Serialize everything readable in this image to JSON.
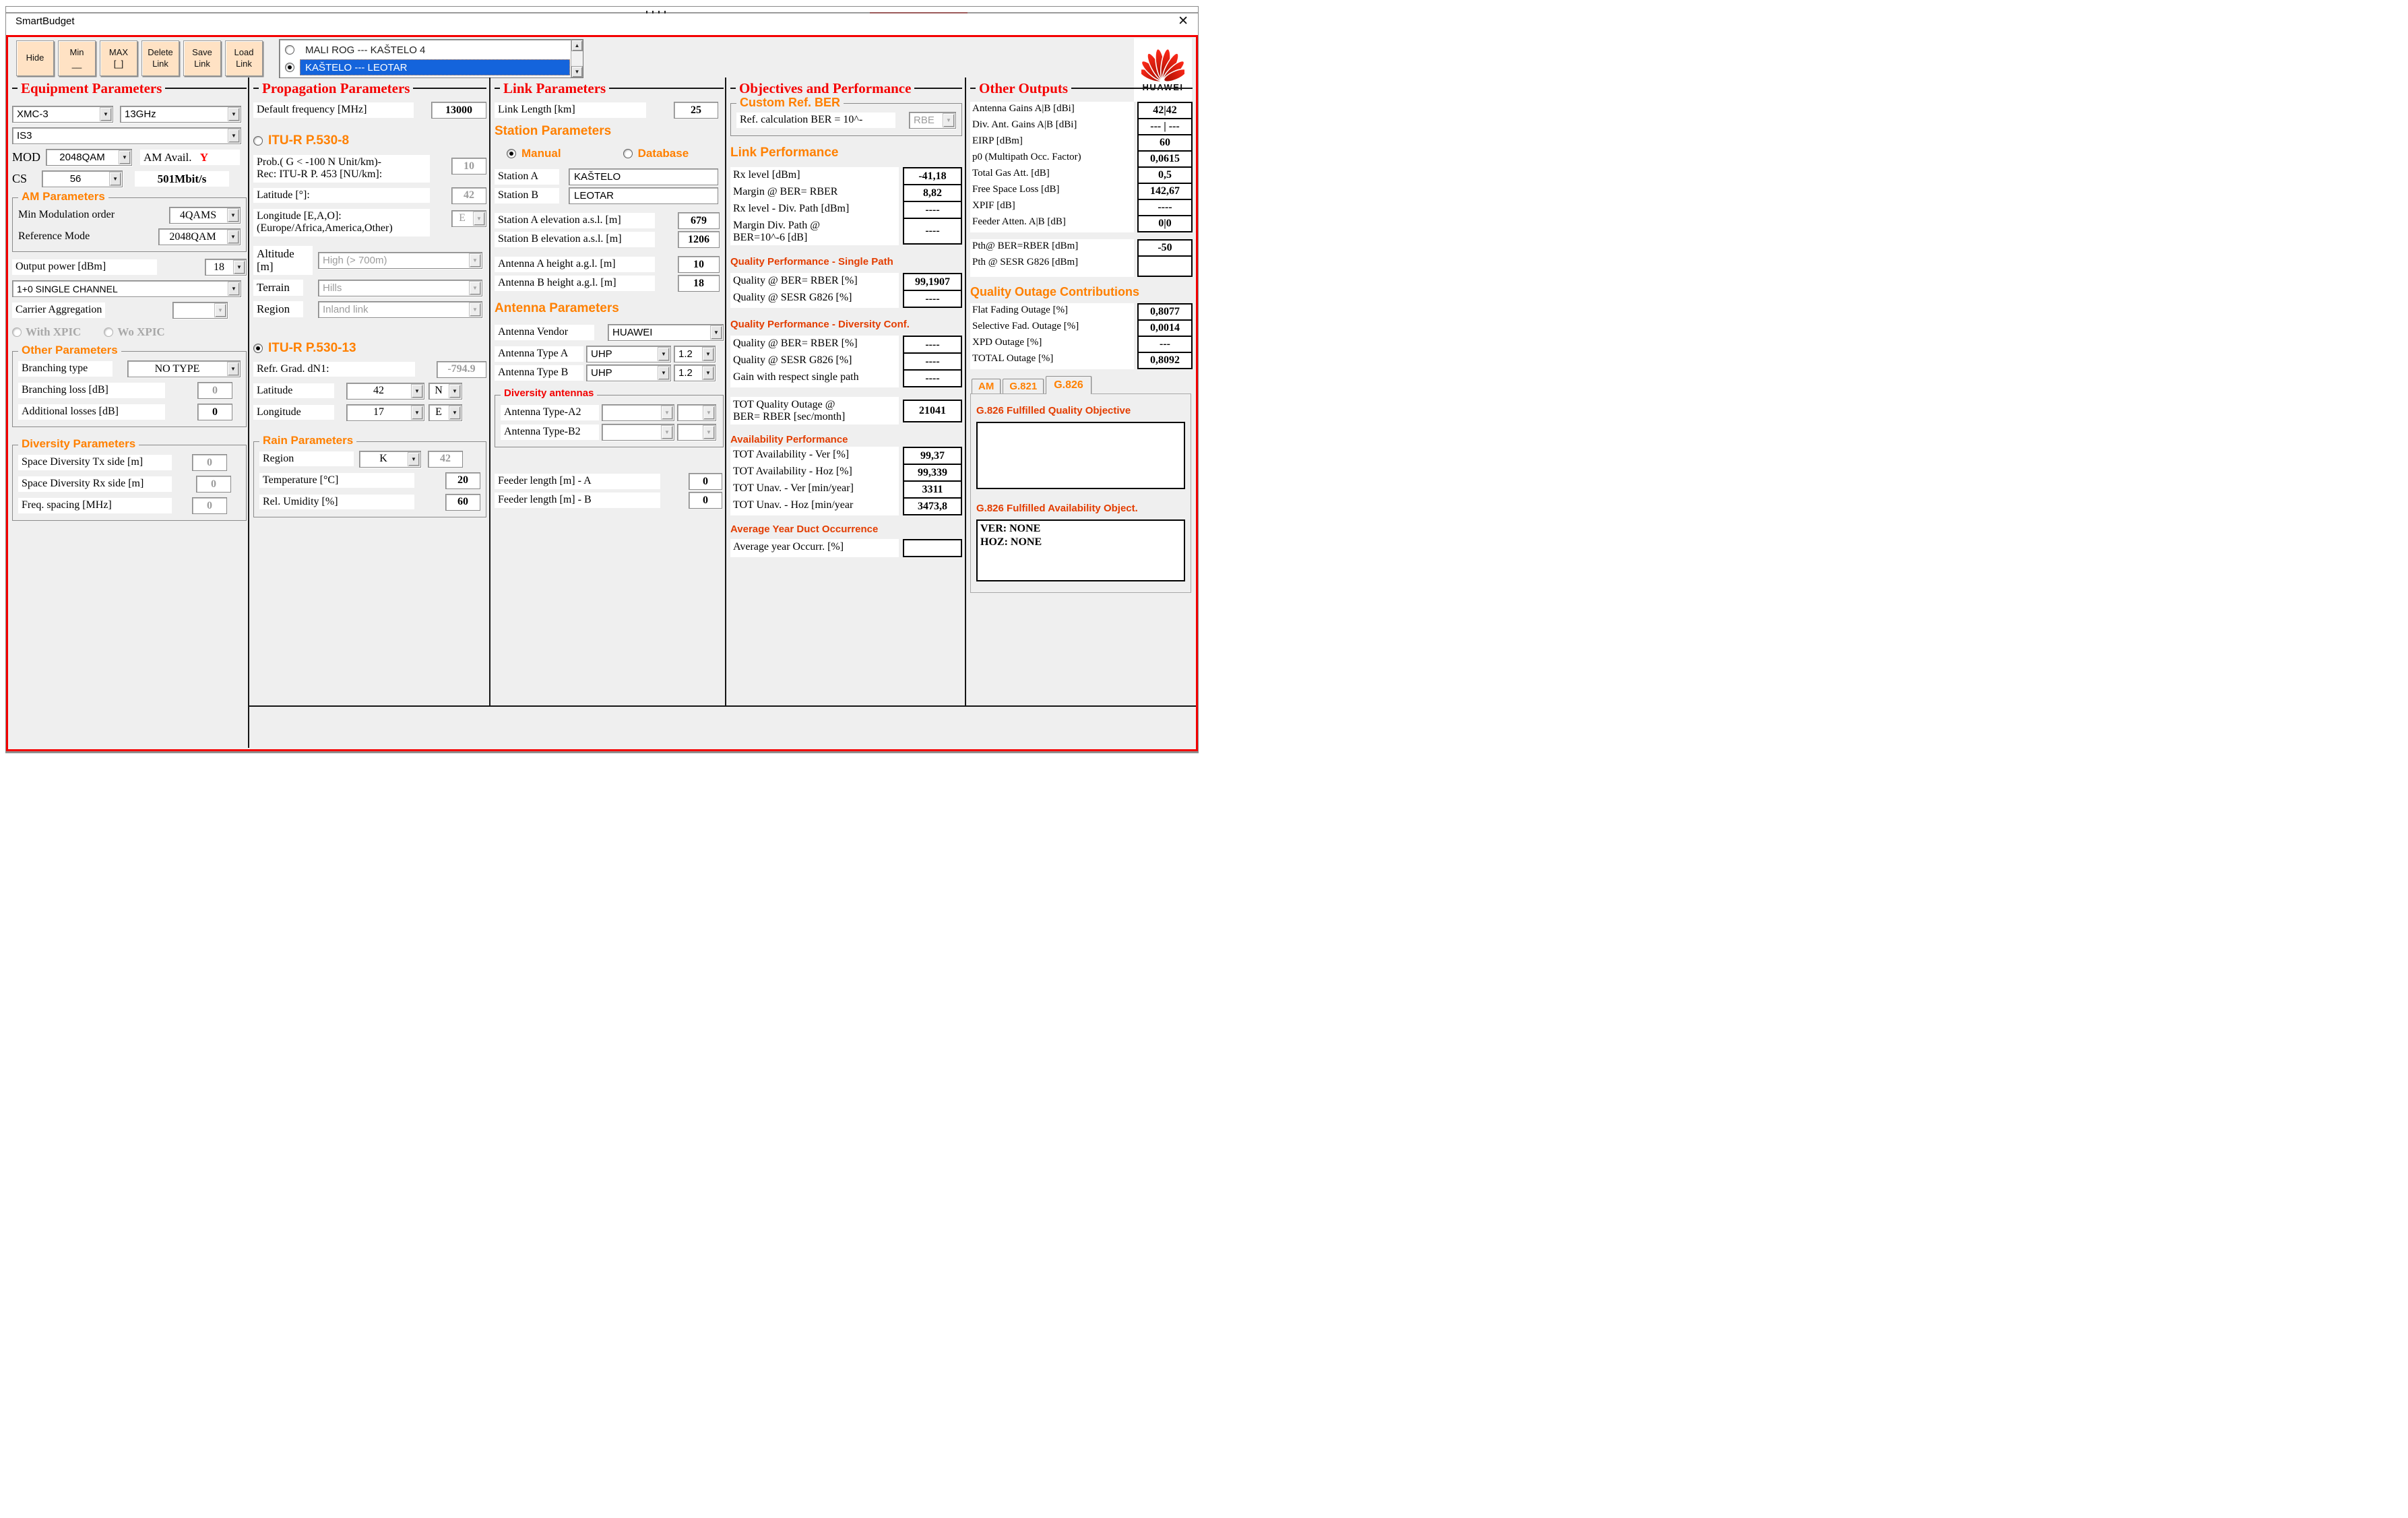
{
  "colors": {
    "accent_red": "#f50000",
    "orange": "#ff8000",
    "deep_orange": "#e33d00",
    "button_face": "#ffe2c4",
    "selection_blue": "#1464dc",
    "brand_red": "#cf0a2c"
  },
  "window": {
    "title": "SmartBudget",
    "close_glyph": "✕"
  },
  "toolbar": {
    "buttons": [
      {
        "label": "Hide",
        "sub": ""
      },
      {
        "label": "Min",
        "sub": "__"
      },
      {
        "label": "MAX",
        "sub": "[_]"
      },
      {
        "label": "Delete",
        "sub": "Link"
      },
      {
        "label": "Save",
        "sub": "Link"
      },
      {
        "label": "Load",
        "sub": "Link"
      }
    ],
    "link_list": {
      "items": [
        {
          "label": "MALI ROG  --- KAŠTELO 4",
          "selected": false
        },
        {
          "label": "KAŠTELO   --- LEOTAR",
          "selected": true
        }
      ],
      "scroll_up": "▲",
      "scroll_down": "▼"
    }
  },
  "logo": {
    "brand": "HUAWEI"
  },
  "equipment": {
    "title": "Equipment Parameters",
    "idu_model": "XMC-3",
    "band": "13GHz",
    "config": "IS3",
    "mod_label": "MOD",
    "mod_value": "2048QAM",
    "am_avail_label": "AM Avail.",
    "am_avail_value": "Y",
    "cs_label": "CS",
    "cs_value": "56",
    "capacity": "501Mbit/s",
    "am_params": {
      "title": "AM Parameters",
      "min_mod_label": "Min Modulation order",
      "min_mod_value": "4QAMS",
      "ref_mode_label": "Reference Mode",
      "ref_mode_value": "2048QAM"
    },
    "output_power_label": "Output power [dBm]",
    "output_power_value": "18",
    "channel_config": "1+0 SINGLE CHANNEL",
    "carrier_agg_label": "Carrier Aggregation",
    "carrier_agg_value": "",
    "xpic_with": "With XPIC",
    "xpic_wo": "Wo XPIC",
    "other_params": {
      "title": "Other  Parameters",
      "branching_type_label": "Branching type",
      "branching_type_value": "NO TYPE",
      "branching_loss_label": "Branching loss [dB]",
      "branching_loss_value": "0",
      "additional_losses_label": "Additional losses [dB]",
      "additional_losses_value": "0"
    },
    "diversity_params": {
      "title": "Diversity Parameters",
      "sd_tx_label": "Space Diversity Tx side [m]",
      "sd_tx_value": "0",
      "sd_rx_label": "Space Diversity Rx side [m]",
      "sd_rx_value": "0",
      "freq_sp_label": "Freq. spacing [MHz]",
      "freq_sp_value": "0"
    }
  },
  "propagation": {
    "title": "Propagation Parameters",
    "freq_label": "Default frequency  [MHz]",
    "freq_value": "13000",
    "p530_8": {
      "label": "ITU-R P.530-8",
      "selected": false
    },
    "prob_label1": "Prob.( G < -100 N Unit/km)-",
    "prob_label2": "Rec: ITU-R  P. 453 [NU/km]:",
    "prob_value": "10",
    "lat8_label": "Latitude [°]:",
    "lat8_value": "42",
    "lon8_label1": "Longitude [E,A,O]:",
    "lon8_label2": "(Europe/Africa,America,Other)",
    "lon8_value": "E",
    "altitude_label": "Altitude [m]",
    "altitude_value": "High (> 700m)",
    "terrain_label": "Terrain",
    "terrain_value": "Hills",
    "region_label": "Region",
    "region_value": "Inland link",
    "p530_13": {
      "label": "ITU-R P.530-13",
      "selected": true
    },
    "refr_label": "Refr. Grad. dN1:",
    "refr_value": "-794.9",
    "lat_label": "Latitude",
    "lat_value": "42",
    "lat_hemi": "N",
    "lon_label": "Longitude",
    "lon_value": "17",
    "lon_hemi": "E",
    "rain": {
      "title": "Rain Parameters",
      "region_label": "Region",
      "region_value": "K",
      "region_num": "42",
      "temp_label": "Temperature [°C]",
      "temp_value": "20",
      "humidity_label": "Rel. Umidity [%]",
      "humidity_value": "60"
    }
  },
  "link": {
    "title": "Link Parameters",
    "length_label": "Link Length  [km]",
    "length_value": "25",
    "station_params_title": "Station Parameters",
    "manual_label": "Manual",
    "database_label": "Database",
    "station_a_label": "Station A",
    "station_a_value": "KAŠTELO",
    "station_b_label": "Station B",
    "station_b_value": "LEOTAR",
    "elev_a_label": "Station A elevation a.s.l. [m]",
    "elev_a_value": "679",
    "elev_b_label": "Station B elevation a.s.l. [m]",
    "elev_b_value": "1206",
    "ant_a_label": "Antenna A  height a.g.l. [m]",
    "ant_a_value": "10",
    "ant_b_label": "Antenna B height a.g.l. [m]",
    "ant_b_value": "18",
    "antenna_params_title": "Antenna Parameters",
    "vendor_label": "Antenna Vendor",
    "vendor_value": "HUAWEI",
    "type_a_label": "Antenna Type A",
    "type_a_value": "UHP",
    "type_a_size": "1.2",
    "type_b_label": "Antenna Type B",
    "type_b_value": "UHP",
    "type_b_size": "1.2",
    "diversity_title": "Diversity antennas",
    "type_a2_label": "Antenna Type-A2",
    "type_a2_value": "",
    "type_a2_size": "",
    "type_b2_label": "Antenna Type-B2",
    "type_b2_value": "",
    "type_b2_size": "",
    "feeder_a_label": "Feeder length [m] - A",
    "feeder_a_value": "0",
    "feeder_b_label": "Feeder length [m] - B",
    "feeder_b_value": "0"
  },
  "objectives": {
    "title": "Objectives and Performance",
    "custom_ber": {
      "title": "Custom  Ref. BER",
      "label": "Ref. calculation BER = 10^-",
      "value": "RBE"
    },
    "link_perf": {
      "title": "Link Performance",
      "rows": [
        {
          "label": "Rx  level [dBm]",
          "value": "-41,18"
        },
        {
          "label": "Margin @ BER= RBER",
          "value": "8,82"
        },
        {
          "label": "Rx  level - Div. Path [dBm]",
          "value": "----"
        },
        {
          "label": "Margin Div. Path @",
          "label2": "BER=10^-6 [dB]",
          "value": "----"
        }
      ]
    },
    "qp_single": {
      "title": "Quality Performance - Single Path",
      "rows": [
        {
          "label": "Quality @ BER= RBER [%]",
          "value": "99,1907"
        },
        {
          "label": "Quality @ SESR G826 [%]",
          "value": "----"
        }
      ]
    },
    "qp_div": {
      "title": "Quality Performance - Diversity Conf.",
      "rows": [
        {
          "label": "Quality @ BER= RBER [%]",
          "value": "----"
        },
        {
          "label": "Quality @ SESR G826 [%]",
          "value": "----"
        },
        {
          "label": "Gain with respect single path",
          "value": "----"
        }
      ]
    },
    "tot_outage": {
      "label1": "TOT Quality Outage @",
      "label2": "BER= RBER [sec/month]",
      "value": "21041"
    },
    "availability": {
      "title": "Availability Performance",
      "rows": [
        {
          "label": "TOT Availability - Ver [%]",
          "value": "99,37"
        },
        {
          "label": "TOT Availability - Hoz [%]",
          "value": "99,339"
        },
        {
          "label": "TOT Unav. - Ver [min/year]",
          "value": "3311"
        },
        {
          "label": "TOT Unav. - Hoz [min/year",
          "value": "3473,8"
        }
      ]
    },
    "duct": {
      "title": "Average Year Duct Occurrence",
      "label": "Average year Occurr. [%]",
      "value": ""
    }
  },
  "outputs": {
    "title": "Other Outputs",
    "rows": [
      {
        "label": "Antenna Gains A|B [dBi]",
        "value": "42|42"
      },
      {
        "label": "Div. Ant. Gains A|B [dBi]",
        "value": "--- | ---"
      },
      {
        "label": "EIRP [dBm]",
        "value": "60"
      },
      {
        "label": "p0 (Multipath Occ. Factor)",
        "value": "0,0615"
      },
      {
        "label": "Total Gas Att. [dB]",
        "value": "0,5"
      },
      {
        "label": "Free Space Loss [dB]",
        "value": "142,67"
      },
      {
        "label": "XPIF [dB]",
        "value": "----"
      },
      {
        "label": "Feeder Atten.  A|B [dB]",
        "value": "0|0"
      }
    ],
    "pth_rber_label": "Pth@ BER=RBER [dBm]",
    "pth_rber_value": "-50",
    "pth_sesr_label": "Pth @ SESR G826 [dBm]",
    "pth_sesr_value": "",
    "outage": {
      "title": "Quality Outage Contributions",
      "rows": [
        {
          "label": "Flat Fading Outage [%]",
          "value": "0,8077"
        },
        {
          "label": "Selective Fad. Outage [%]",
          "value": "0,0014"
        },
        {
          "label": "XPD Outage [%]",
          "value": "---"
        },
        {
          "label": "TOTAL Outage [%]",
          "value": "0,8092"
        }
      ]
    },
    "tabs": [
      {
        "label": "AM"
      },
      {
        "label": "G.821"
      },
      {
        "label": "G.826"
      }
    ],
    "active_tab": "G.826",
    "g826_quality_title": "G.826 Fulfilled Quality  Objective",
    "g826_quality_value": "",
    "g826_avail_title": "G.826 Fulfilled Availability  Object.",
    "g826_avail_line1": "VER: NONE",
    "g826_avail_line2": "HOZ: NONE"
  }
}
